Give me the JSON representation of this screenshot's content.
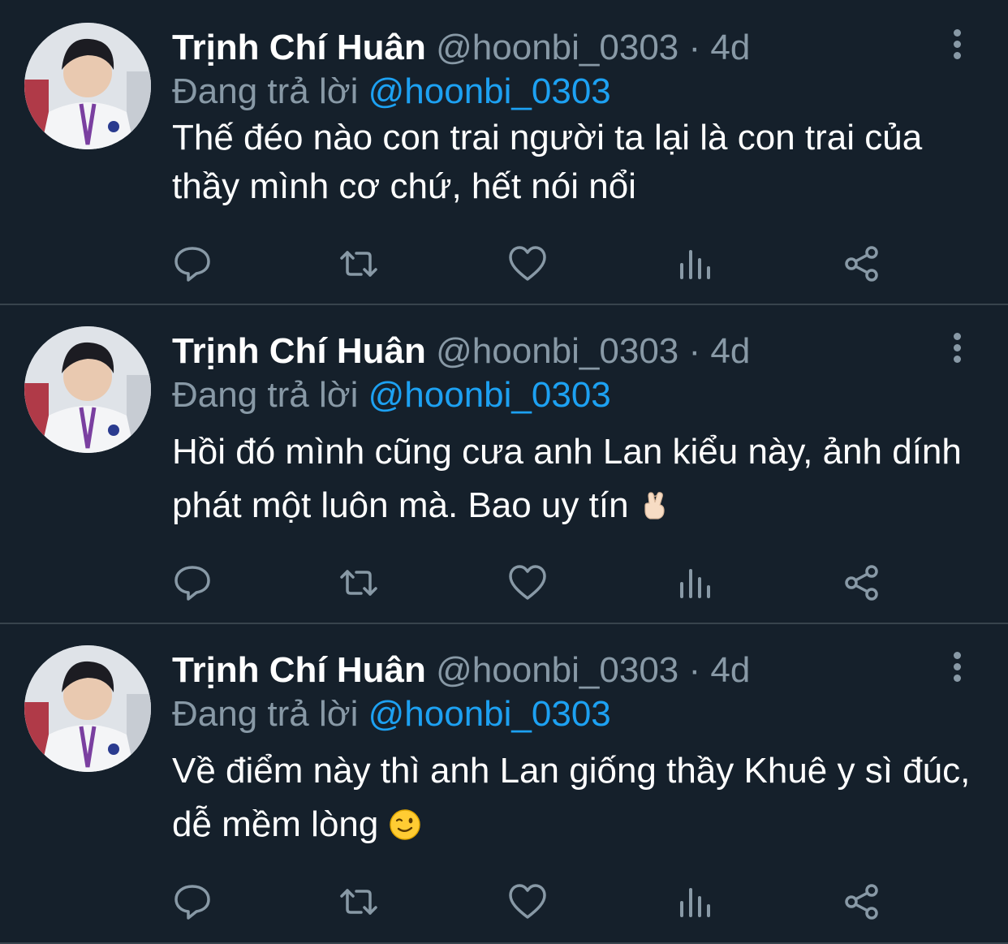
{
  "tweets": [
    {
      "name": "Trịnh Chí Huân",
      "handle": "@hoonbi_0303",
      "dot": "·",
      "time": "4d",
      "replying_label": "Đang trả lời",
      "replying_to": "@hoonbi_0303",
      "text": "Thế đéo nào con trai người ta lại là con trai của thầy mình cơ chứ, hết nói nổi",
      "emoji": ""
    },
    {
      "name": "Trịnh Chí Huân",
      "handle": "@hoonbi_0303",
      "dot": "·",
      "time": "4d",
      "replying_label": "Đang trả lời",
      "replying_to": "@hoonbi_0303",
      "text": "Hồi đó mình cũng cưa anh Lan kiểu này, ảnh dính phát một luôn mà. Bao uy tín",
      "emoji": "crossed-fingers-emoji"
    },
    {
      "name": "Trịnh Chí Huân",
      "handle": "@hoonbi_0303",
      "dot": "·",
      "time": "4d",
      "replying_label": "Đang trả lời",
      "replying_to": "@hoonbi_0303",
      "text": "Về điểm này thì anh Lan giống thầy Khuê y sì đúc, dễ mềm lòng",
      "emoji": "winking-face-emoji"
    }
  ],
  "icons": {
    "reply": "reply-icon",
    "retweet": "retweet-icon",
    "like": "like-icon",
    "analytics": "analytics-icon",
    "share": "share-icon",
    "more": "more-vertical-icon"
  },
  "colors": {
    "background": "#15202b",
    "text": "#ffffff",
    "secondary": "#8899a6",
    "link": "#1da1f2",
    "divider": "#38444d"
  }
}
